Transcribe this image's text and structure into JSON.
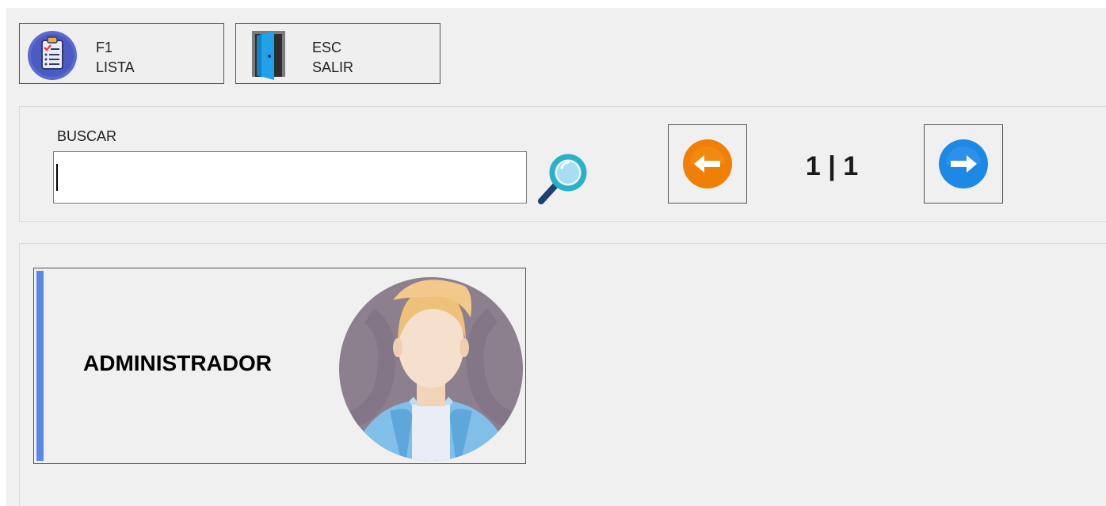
{
  "toolbar": {
    "buttons": [
      {
        "key": "F1",
        "label": "LISTA",
        "icon": "clipboard-list-icon"
      },
      {
        "key": "ESC",
        "label": "SALIR",
        "icon": "exit-door-icon"
      }
    ]
  },
  "search": {
    "label": "BUSCAR",
    "value": "",
    "placeholder": "",
    "button_icon": "magnifier-icon"
  },
  "pagination": {
    "counter": "1 | 1",
    "prev_icon": "arrow-left-icon",
    "next_icon": "arrow-right-icon",
    "prev_color": "#ef7f05",
    "next_color": "#1e88e5"
  },
  "users": [
    {
      "name": "ADMINISTRADOR",
      "avatar": "user-avatar-icon",
      "accent_color": "#5b87e8"
    }
  ]
}
